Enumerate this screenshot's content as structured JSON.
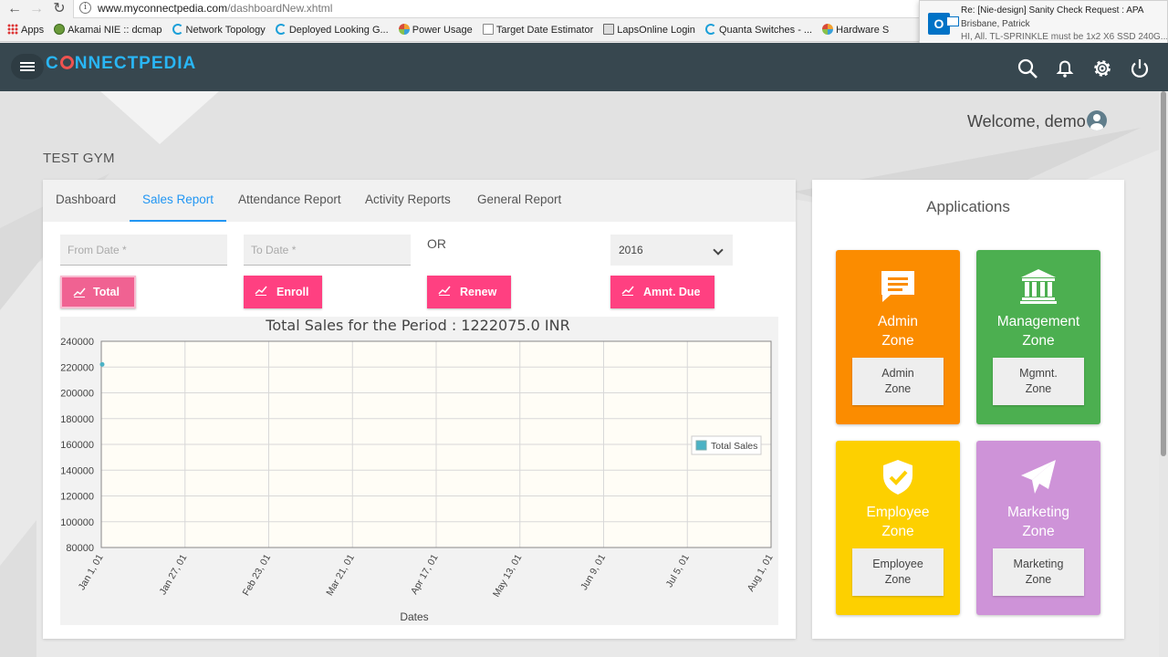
{
  "browser": {
    "url_host": "www.myconnectpedia.com",
    "url_path": "/dashboardNew.xhtml",
    "bookmarks": [
      {
        "label": "Apps",
        "icon": "apps-grid-icon"
      },
      {
        "label": "Akamai NIE :: dcmap",
        "icon": "akamai-icon"
      },
      {
        "label": "Network Topology",
        "icon": "arc-icon"
      },
      {
        "label": "Deployed Looking G...",
        "icon": "arc-icon"
      },
      {
        "label": "Power Usage",
        "icon": "wheel-icon"
      },
      {
        "label": "Target Date Estimator",
        "icon": "doc-icon"
      },
      {
        "label": "LapsOnline Login",
        "icon": "image-icon"
      },
      {
        "label": "Quanta Switches - ...",
        "icon": "arc-icon"
      },
      {
        "label": "Hardware S",
        "icon": "wheel-icon"
      }
    ]
  },
  "notification": {
    "subject": "Re: [Nie-design] Sanity Check Request : APA",
    "sender": "Brisbane, Patrick",
    "preview": "HI, All. TL-SPRINKLE must be 1x2 X6 SSD 240G..."
  },
  "app": {
    "logo": {
      "pre": "C",
      "post": "NNECTPEDIA"
    },
    "welcome": "Welcome, demo",
    "gym_name": "TEST GYM"
  },
  "tabs": [
    "Dashboard",
    "Sales Report",
    "Attendance Report",
    "Activity Reports",
    "General Report"
  ],
  "filters": {
    "from_placeholder": "From Date *",
    "to_placeholder": "To Date *",
    "or_label": "OR",
    "year": "2016"
  },
  "buttons": [
    "Total",
    "Enroll",
    "Renew",
    "Amnt. Due"
  ],
  "chart_data": {
    "type": "line",
    "title": "Total Sales for the Period : 1222075.0 INR",
    "xlabel": "Dates",
    "ylabel": "",
    "ylim": [
      80000,
      240000
    ],
    "yticks": [
      240000,
      220000,
      200000,
      180000,
      160000,
      140000,
      120000,
      100000,
      80000
    ],
    "xticks": [
      "Jan 1, 01",
      "Jan 27, 01",
      "Feb 23, 01",
      "Mar 21, 01",
      "Apr 17, 01",
      "May 13, 01",
      "Jun 9, 01",
      "Jul 5, 01",
      "Aug 1, 01"
    ],
    "series": [
      {
        "name": "Total Sales",
        "values": [
          {
            "x": "Jan 1, 01",
            "y": 222075
          }
        ]
      }
    ],
    "grid": true,
    "legend": "right"
  },
  "applications": {
    "title": "Applications",
    "tiles": [
      {
        "name": "Admin Zone",
        "button": "Admin Zone",
        "color": "#fb8c00",
        "icon": "chat-icon"
      },
      {
        "name": "Management Zone",
        "button": "Mgmnt. Zone",
        "color": "#4caf50",
        "icon": "bank-icon"
      },
      {
        "name": "Employee Zone",
        "button": "Employee Zone",
        "color": "#fdd000",
        "icon": "shield-check-icon"
      },
      {
        "name": "Marketing Zone",
        "button": "Marketing Zone",
        "color": "#ce93d8",
        "icon": "paper-plane-icon"
      }
    ]
  }
}
